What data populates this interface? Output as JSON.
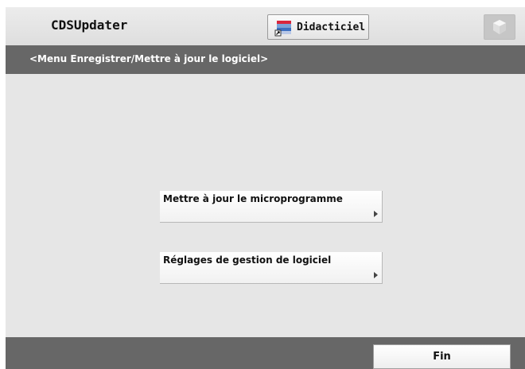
{
  "header": {
    "app_title": "CDSUpdater",
    "tutorial_button": {
      "label": "Didacticiel",
      "icon": "tutorial-icon"
    },
    "system_button": {
      "icon": "cube-icon"
    }
  },
  "breadcrumb": {
    "text": "<Menu Enregistrer/Mettre à jour le logiciel>"
  },
  "menu": {
    "items": [
      {
        "label": "Mettre à jour le microprogramme",
        "icon": "chevron-right-icon"
      },
      {
        "label": "Réglages de gestion de logiciel",
        "icon": "chevron-right-icon"
      }
    ]
  },
  "footer": {
    "end_button": "Fin"
  },
  "colors": {
    "background": "#e6e6e6",
    "bar": "#676767",
    "button": "#ffffff"
  }
}
